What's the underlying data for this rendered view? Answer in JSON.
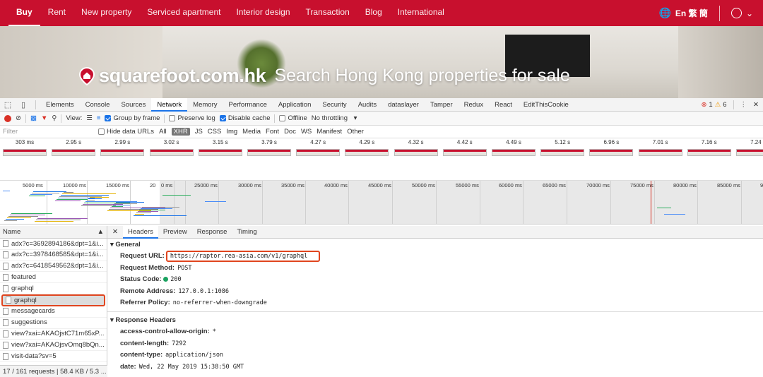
{
  "site": {
    "nav": [
      "Buy",
      "Rent",
      "New property",
      "Serviced apartment",
      "Interior design",
      "Transaction",
      "Blog",
      "International"
    ],
    "lang": "En 繁 簡",
    "logo": "squarefoot.com.hk",
    "tagline": "Search Hong Kong properties for sale"
  },
  "devtools": {
    "tabs": [
      "Elements",
      "Console",
      "Sources",
      "Network",
      "Memory",
      "Performance",
      "Application",
      "Security",
      "Audits",
      "dataslayer",
      "Tamper",
      "Redux",
      "React",
      "EditThisCookie"
    ],
    "errors": "1",
    "warnings": "6",
    "toolbar": {
      "view": "View:",
      "group_by_frame": "Group by frame",
      "preserve_log": "Preserve log",
      "disable_cache": "Disable cache",
      "offline": "Offline",
      "throttling": "No throttling"
    },
    "filter": {
      "placeholder": "Filter",
      "hide_data_urls": "Hide data URLs",
      "types": [
        "All",
        "XHR",
        "JS",
        "CSS",
        "Img",
        "Media",
        "Font",
        "Doc",
        "WS",
        "Manifest",
        "Other"
      ]
    },
    "screenshot_times": [
      "303 ms",
      "2.95 s",
      "2.99 s",
      "3.02 s",
      "3.15 s",
      "3.79 s",
      "4.27 s",
      "4.29 s",
      "4.32 s",
      "4.42 s",
      "4.49 s",
      "5.12 s",
      "6.96 s",
      "7.01 s",
      "7.16 s",
      "7.24 s"
    ],
    "overview_ticks": [
      "5000 ms",
      "10000 ms",
      "15000 ms",
      "20",
      "0 ms",
      "25000 ms",
      "30000 ms",
      "35000 ms",
      "40000 ms",
      "45000 ms",
      "50000 ms",
      "55000 ms",
      "60000 ms",
      "65000 ms",
      "70000 ms",
      "75000 ms",
      "80000 ms",
      "85000 ms",
      "9"
    ],
    "requests": {
      "header": "Name",
      "items": [
        "adx?c=3692894186&dpt=1&i...",
        "adx?c=3978468585&dpt=1&i...",
        "adx?c=6418549562&dpt=1&i...",
        "featured",
        "graphql",
        "graphql",
        "messagecards",
        "suggestions",
        "view?xai=AKAOjstC71m65xP...",
        "view?xai=AKAOjsvOmq8bQn...",
        "visit-data?sv=5"
      ],
      "selected": 5,
      "footer": "17 / 161 requests | 58.4 KB / 5.3 ..."
    },
    "detail": {
      "tabs": [
        "Headers",
        "Preview",
        "Response",
        "Timing"
      ],
      "general_title": "General",
      "general": [
        {
          "k": "Request URL:",
          "v": "https://raptor.rea-asia.com/v1/graphql"
        },
        {
          "k": "Request Method:",
          "v": "POST"
        },
        {
          "k": "Status Code:",
          "v": "200"
        },
        {
          "k": "Remote Address:",
          "v": "127.0.0.1:1086"
        },
        {
          "k": "Referrer Policy:",
          "v": "no-referrer-when-downgrade"
        }
      ],
      "response_title": "Response Headers",
      "response": [
        {
          "k": "access-control-allow-origin:",
          "v": "*"
        },
        {
          "k": "content-length:",
          "v": "7292"
        },
        {
          "k": "content-type:",
          "v": "application/json"
        },
        {
          "k": "date:",
          "v": "Wed, 22 May 2019 15:38:50 GMT"
        }
      ]
    }
  }
}
